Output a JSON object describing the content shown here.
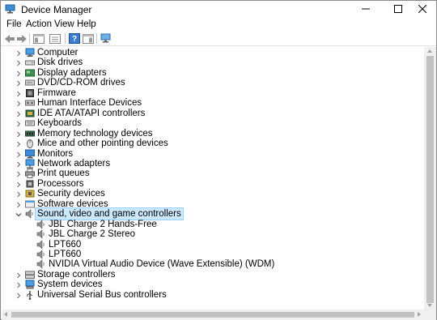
{
  "window": {
    "title": "Device Manager"
  },
  "menu": [
    "File",
    "Action",
    "View",
    "Help"
  ],
  "tree": [
    {
      "label": "Computer",
      "icon": "computer-icon",
      "expanded": false
    },
    {
      "label": "Disk drives",
      "icon": "disk-drive-icon",
      "expanded": false
    },
    {
      "label": "Display adapters",
      "icon": "display-adapter-icon",
      "expanded": false
    },
    {
      "label": "DVD/CD-ROM drives",
      "icon": "dvd-drive-icon",
      "expanded": false
    },
    {
      "label": "Firmware",
      "icon": "firmware-icon",
      "expanded": false
    },
    {
      "label": "Human Interface Devices",
      "icon": "hid-icon",
      "expanded": false
    },
    {
      "label": "IDE ATA/ATAPI controllers",
      "icon": "ide-controller-icon",
      "expanded": false
    },
    {
      "label": "Keyboards",
      "icon": "keyboard-icon",
      "expanded": false
    },
    {
      "label": "Memory technology devices",
      "icon": "memory-icon",
      "expanded": false
    },
    {
      "label": "Mice and other pointing devices",
      "icon": "mouse-icon",
      "expanded": false
    },
    {
      "label": "Monitors",
      "icon": "monitor-icon",
      "expanded": false
    },
    {
      "label": "Network adapters",
      "icon": "network-adapter-icon",
      "expanded": false
    },
    {
      "label": "Print queues",
      "icon": "printer-icon",
      "expanded": false
    },
    {
      "label": "Processors",
      "icon": "processor-icon",
      "expanded": false
    },
    {
      "label": "Security devices",
      "icon": "security-device-icon",
      "expanded": false
    },
    {
      "label": "Software devices",
      "icon": "software-device-icon",
      "expanded": false
    },
    {
      "label": "Sound, video and game controllers",
      "icon": "speaker-icon",
      "expanded": true,
      "selected": true,
      "children": [
        {
          "label": "JBL Charge 2 Hands-Free",
          "icon": "speaker-icon"
        },
        {
          "label": "JBL Charge 2 Stereo",
          "icon": "speaker-icon"
        },
        {
          "label": "LPT660",
          "icon": "speaker-icon"
        },
        {
          "label": "LPT660",
          "icon": "speaker-icon"
        },
        {
          "label": "NVIDIA Virtual Audio Device (Wave Extensible) (WDM)",
          "icon": "speaker-icon"
        }
      ]
    },
    {
      "label": "Storage controllers",
      "icon": "storage-controller-icon",
      "expanded": false
    },
    {
      "label": "System devices",
      "icon": "system-device-icon",
      "expanded": false
    },
    {
      "label": "Universal Serial Bus controllers",
      "icon": "usb-icon",
      "expanded": false
    }
  ],
  "colors": {
    "selection": "#cce8ff",
    "selection_border": "#99d1ff",
    "accent": "#1e73c8"
  }
}
